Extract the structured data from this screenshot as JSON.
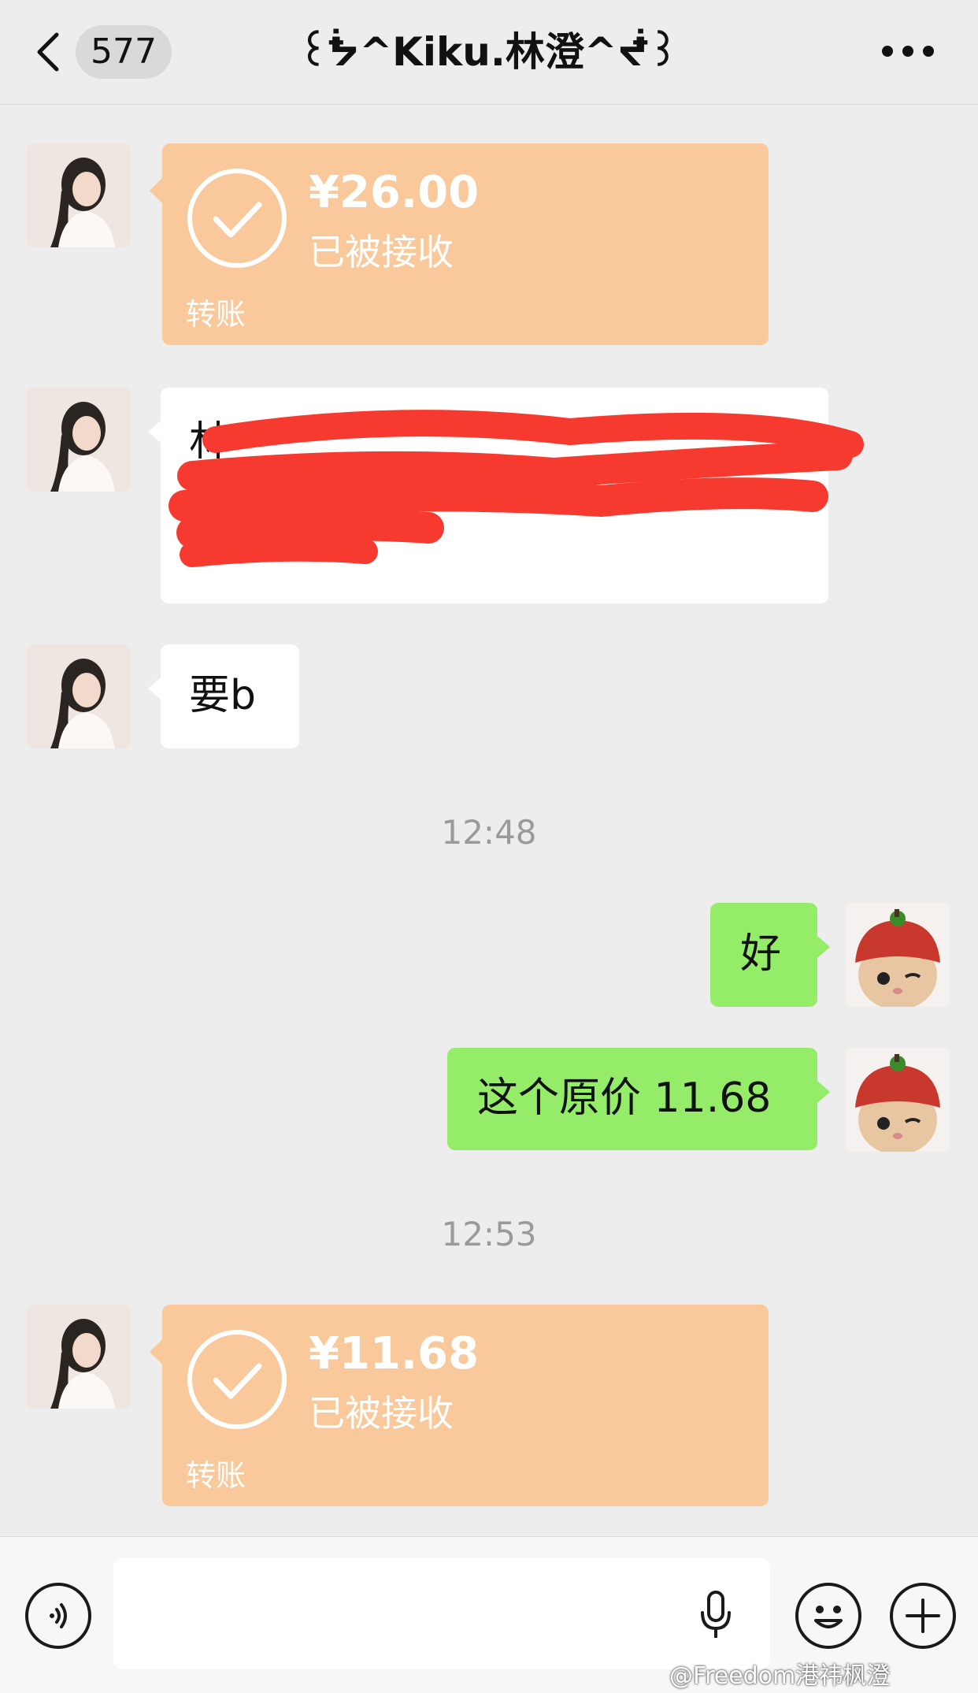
{
  "header": {
    "unread_count": "577",
    "title": "꒰ᖭ^Kiku.林澄^ᖫ꒱"
  },
  "messages": {
    "transfer_1": {
      "amount": "¥26.00",
      "status": "已被接收",
      "label": "转账"
    },
    "redacted_text_visible": "林",
    "text_1": "要b",
    "time_1": "12:48",
    "reply_1": "好",
    "reply_2": "这个原价 11.68",
    "time_2": "12:53",
    "transfer_2": {
      "amount": "¥11.68",
      "status": "已被接收",
      "label": "转账"
    }
  },
  "input": {
    "placeholder": ""
  },
  "icons": {
    "back": "chevron-left-icon",
    "more": "more-icon",
    "voice": "voice-icon",
    "mic": "microphone-icon",
    "emoji": "emoji-icon",
    "add": "plus-icon"
  },
  "colors": {
    "background": "#ededed",
    "transfer_bubble": "#f9c99b",
    "outgoing_bubble": "#95ec69",
    "incoming_bubble": "#ffffff",
    "redaction": "#f73a2f"
  },
  "watermark": "@Freedom港祎枫澄"
}
